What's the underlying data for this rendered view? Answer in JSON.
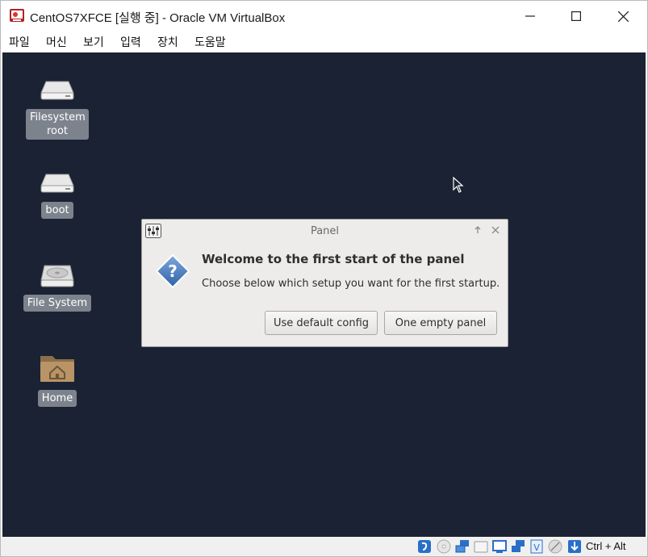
{
  "window": {
    "title": "CentOS7XFCE [실행 중] - Oracle VM VirtualBox"
  },
  "menubar": {
    "items": [
      "파일",
      "머신",
      "보기",
      "입력",
      "장치",
      "도움말"
    ]
  },
  "desktop": {
    "background_color": "#1a2233",
    "icons": [
      {
        "label": "Filesystem root",
        "icon": "drive-icon"
      },
      {
        "label": "boot",
        "icon": "drive-icon"
      },
      {
        "label": "File System",
        "icon": "harddisk-icon"
      },
      {
        "label": "Home",
        "icon": "home-folder-icon"
      }
    ]
  },
  "dialog": {
    "title": "Panel",
    "heading": "Welcome to the first start of the panel",
    "message": "Choose below which setup you want for the first startup.",
    "buttons": {
      "default": "Use default config",
      "empty": "One empty panel"
    }
  },
  "statusbar": {
    "host_key": "Ctrl + Alt",
    "icons": [
      "hard-disk-activity-icon",
      "optical-drive-icon",
      "network-icon",
      "usb-icon",
      "shared-folders-icon",
      "display-icon",
      "recording-icon",
      "virtualization-icon",
      "mouse-integration-icon",
      "keyboard-capture-icon"
    ]
  }
}
